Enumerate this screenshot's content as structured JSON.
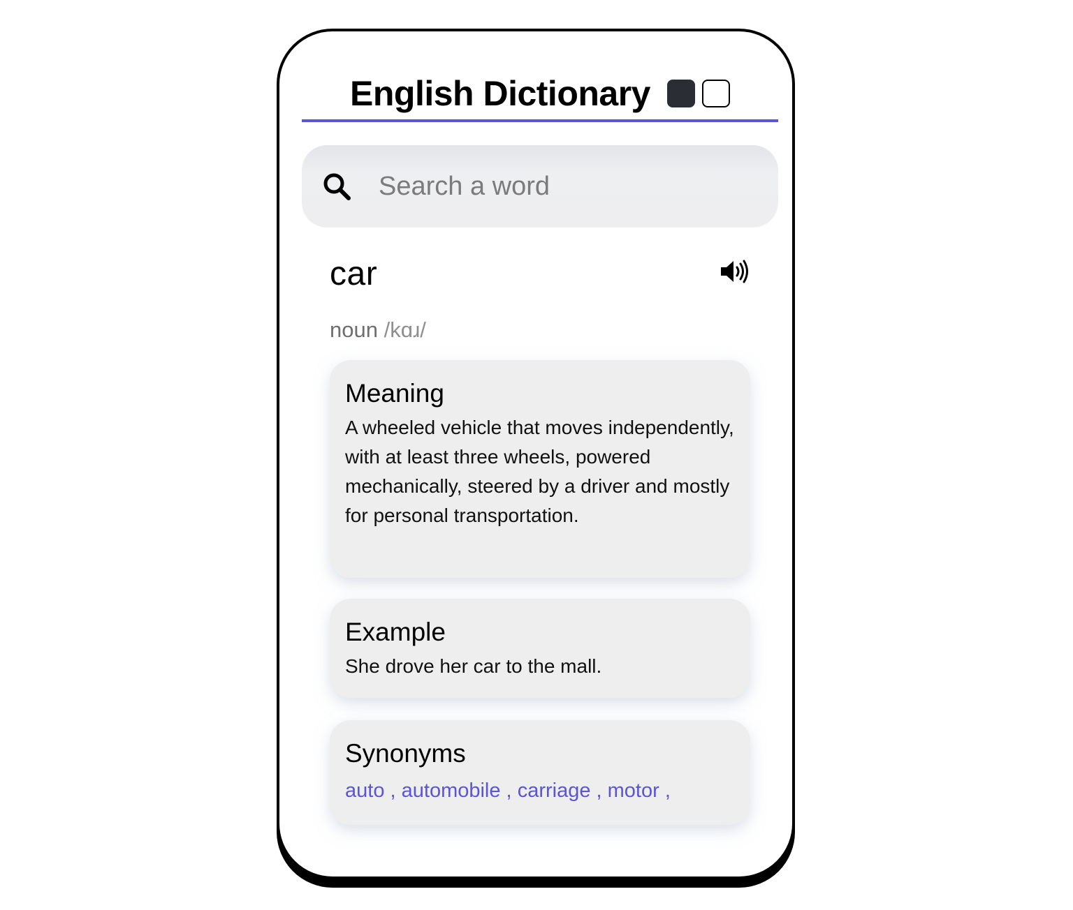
{
  "header": {
    "title": "English Dictionary",
    "theme_dark_color": "#2a2d33",
    "theme_light_color": "#ffffff",
    "accent_color": "#5a55d6"
  },
  "search": {
    "placeholder": "Search a word",
    "value": "",
    "icon": "search-icon"
  },
  "result": {
    "word": "car",
    "part_of_speech": "noun",
    "phonetic": "/kɑɹ/",
    "audio_icon": "speaker-icon"
  },
  "meaning": {
    "title": "Meaning",
    "text": "A wheeled vehicle that moves independently, with at least three wheels, powered mechanically, steered by a driver and mostly for personal transportation."
  },
  "example": {
    "title": "Example",
    "text": "She drove her car to the mall."
  },
  "synonyms": {
    "title": "Synonyms",
    "items": [
      "auto ,",
      "automobile ,",
      "carriage ,",
      "motor ,"
    ]
  }
}
